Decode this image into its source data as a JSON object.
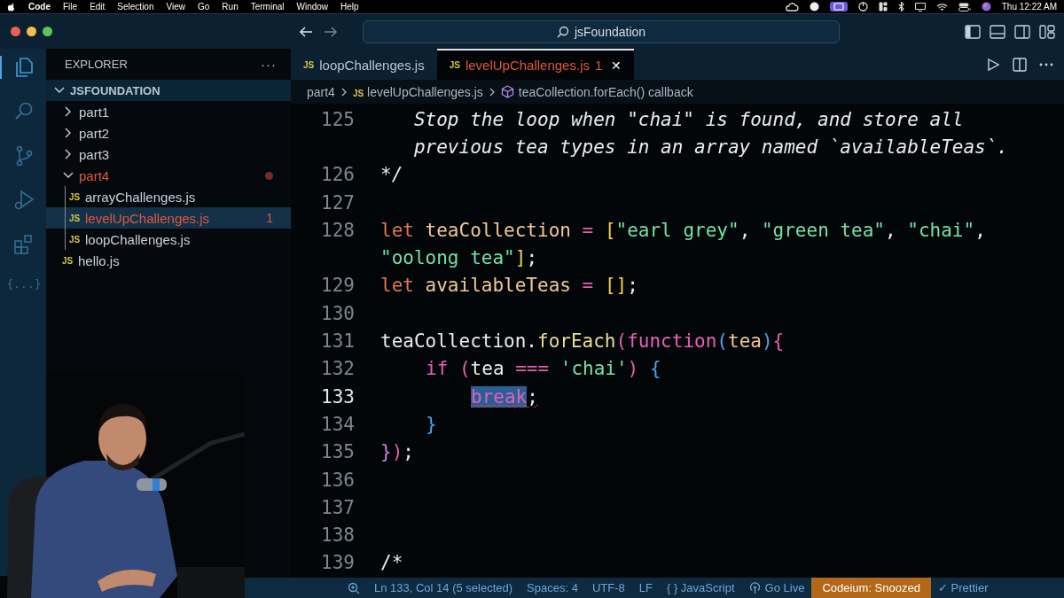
{
  "menubar": {
    "app": "Code",
    "menus": [
      "File",
      "Edit",
      "Selection",
      "View",
      "Go",
      "Run",
      "Terminal",
      "Window",
      "Help"
    ],
    "clock": "Thu 12:22 AM"
  },
  "titlebar": {
    "search": "jsFoundation"
  },
  "activity_bar": [
    {
      "kind": "files",
      "selected": true
    },
    {
      "kind": "search",
      "selected": false
    },
    {
      "kind": "source-control",
      "selected": false
    },
    {
      "kind": "run-debug",
      "selected": false
    },
    {
      "kind": "extensions",
      "selected": false
    },
    {
      "kind": "text",
      "label": "{...}",
      "selected": false
    }
  ],
  "explorer": {
    "title": "EXPLORER",
    "more": "···",
    "root": {
      "label": "JSFOUNDATION",
      "expanded": true
    },
    "items": [
      {
        "kind": "folder",
        "label": "part1",
        "expanded": false,
        "selected": false,
        "has_problems": false
      },
      {
        "kind": "folder",
        "label": "part2",
        "expanded": false,
        "selected": false,
        "has_problems": false
      },
      {
        "kind": "folder",
        "label": "part3",
        "expanded": false,
        "selected": false,
        "has_problems": false
      },
      {
        "kind": "folder",
        "label": "part4",
        "expanded": true,
        "selected": false,
        "has_problems": true,
        "children": [
          {
            "kind": "file",
            "badge": "JS",
            "label": "arrayChallenges.js",
            "selected": false,
            "has_problems": false
          },
          {
            "kind": "file",
            "badge": "JS",
            "label": "levelUpChallenges.js",
            "selected": true,
            "has_problems": true,
            "problems": "1"
          },
          {
            "kind": "file",
            "badge": "JS",
            "label": "loopChallenges.js",
            "selected": false,
            "has_problems": false
          }
        ]
      },
      {
        "kind": "file",
        "badge": "JS",
        "label": "hello.js",
        "selected": false,
        "has_problems": false
      }
    ]
  },
  "tabs": [
    {
      "badge": "JS",
      "label": "loopChallenges.js",
      "selected": false,
      "has_problems": false
    },
    {
      "badge": "JS",
      "label": "levelUpChallenges.js",
      "selected": true,
      "has_problems": true,
      "problems": "1",
      "close": "✕"
    }
  ],
  "breadcrumb": [
    {
      "kind": "folder",
      "label": "part4"
    },
    {
      "kind": "file",
      "badge": "JS",
      "label": "levelUpChallenges.js"
    },
    {
      "kind": "symbol",
      "label": "teaCollection.forEach() callback"
    }
  ],
  "code": [
    {
      "number": "125",
      "current": false,
      "tokens": [
        {
          "kind": "comment",
          "text": "   Stop the loop when \"chai\" is found, and store all"
        }
      ]
    },
    {
      "tokens": [
        {
          "kind": "comment",
          "text": "   previous tea types in an array named `availableTeas`."
        }
      ]
    },
    {
      "number": "126",
      "current": false,
      "tokens": [
        {
          "kind": "comment",
          "text": "*/"
        }
      ]
    },
    {
      "number": "127",
      "current": false
    },
    {
      "number": "128",
      "current": false,
      "tokens": [
        {
          "kind": "keyword",
          "text": "let "
        },
        {
          "kind": "variable",
          "text": "teaCollection "
        },
        {
          "kind": "operator",
          "text": "= "
        },
        {
          "kind": "bracket1",
          "text": "["
        },
        {
          "kind": "string",
          "text": "\"earl grey\""
        },
        {
          "kind": "plain",
          "text": ", "
        },
        {
          "kind": "string",
          "text": "\"green tea\""
        },
        {
          "kind": "plain",
          "text": ", "
        },
        {
          "kind": "string",
          "text": "\"chai\""
        },
        {
          "kind": "plain",
          "text": ","
        }
      ]
    },
    {
      "tokens": [
        {
          "kind": "string",
          "text": "\"oolong tea\""
        },
        {
          "kind": "bracket1",
          "text": "]"
        },
        {
          "kind": "plain",
          "text": ";"
        }
      ]
    },
    {
      "number": "129",
      "current": false,
      "tokens": [
        {
          "kind": "keyword",
          "text": "let "
        },
        {
          "kind": "variable",
          "text": "availableTeas "
        },
        {
          "kind": "operator",
          "text": "= "
        },
        {
          "kind": "bracket1",
          "text": "[]"
        },
        {
          "kind": "plain",
          "text": ";"
        }
      ]
    },
    {
      "number": "130",
      "current": false
    },
    {
      "number": "131",
      "current": false,
      "tokens": [
        {
          "kind": "plain",
          "text": "teaCollection."
        },
        {
          "kind": "method",
          "text": "forEach"
        },
        {
          "kind": "bracket2",
          "text": "("
        },
        {
          "kind": "control",
          "text": "function"
        },
        {
          "kind": "bracket3",
          "text": "("
        },
        {
          "kind": "variable",
          "text": "tea"
        },
        {
          "kind": "bracket3",
          "text": ")"
        },
        {
          "kind": "bracket2",
          "text": "{"
        }
      ]
    },
    {
      "number": "132",
      "current": false,
      "kind": "nested",
      "tokens": [
        {
          "kind": "control",
          "text": "if "
        },
        {
          "kind": "bracket2",
          "text": "("
        },
        {
          "kind": "plain",
          "text": "tea "
        },
        {
          "kind": "operator",
          "text": "=== "
        },
        {
          "kind": "string",
          "text": "'chai'"
        },
        {
          "kind": "bracket2",
          "text": ") "
        },
        {
          "kind": "bracket3",
          "text": "{"
        }
      ]
    },
    {
      "number": "133",
      "current": true,
      "kind": "deep",
      "tokens": [
        {
          "kind": "control",
          "text": "break",
          "selected": true,
          "error": true
        },
        {
          "kind": "plain",
          "text": ";",
          "selected": false,
          "error": true
        }
      ]
    },
    {
      "number": "134",
      "current": false,
      "kind": "nested",
      "tokens": [
        {
          "kind": "bracket3",
          "text": "}"
        }
      ]
    },
    {
      "number": "135",
      "current": false,
      "tokens": [
        {
          "kind": "bracket4",
          "text": "}"
        },
        {
          "kind": "bracket2",
          "text": ")"
        },
        {
          "kind": "plain",
          "text": ";"
        }
      ]
    },
    {
      "number": "136",
      "current": false
    },
    {
      "number": "137",
      "current": false
    },
    {
      "number": "138",
      "current": false
    },
    {
      "number": "139",
      "current": false,
      "tokens": [
        {
          "kind": "plain",
          "text": "/*"
        }
      ]
    }
  ],
  "status_bar": [
    {
      "kind": "zoom"
    },
    {
      "kind": "text",
      "label": "Ln 133, Col 14 (5 selected)"
    },
    {
      "kind": "text",
      "label": "Spaces: 4"
    },
    {
      "kind": "text",
      "label": "UTF-8"
    },
    {
      "kind": "text",
      "label": "LF"
    },
    {
      "kind": "text",
      "label": "{ } JavaScript"
    },
    {
      "kind": "broadcast",
      "label": "Go Live"
    },
    {
      "kind": "highlight",
      "label": "Codeium: Snoozed"
    },
    {
      "kind": "text",
      "label": "✓ Prettier"
    }
  ]
}
